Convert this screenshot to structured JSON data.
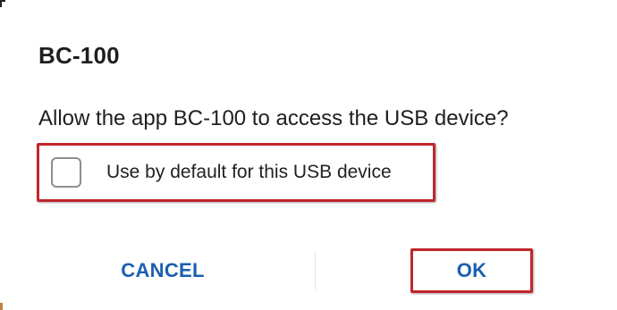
{
  "dialog": {
    "title": "BC-100",
    "message": "Allow the app BC-100 to access the USB device?",
    "checkbox": {
      "label": "Use by default for this USB device",
      "checked": false
    },
    "buttons": {
      "cancel_label": "CANCEL",
      "ok_label": "OK"
    }
  },
  "colors": {
    "accent": "#1b5fb0",
    "highlight_border": "#c0272d",
    "text": "#1f1f1f"
  }
}
